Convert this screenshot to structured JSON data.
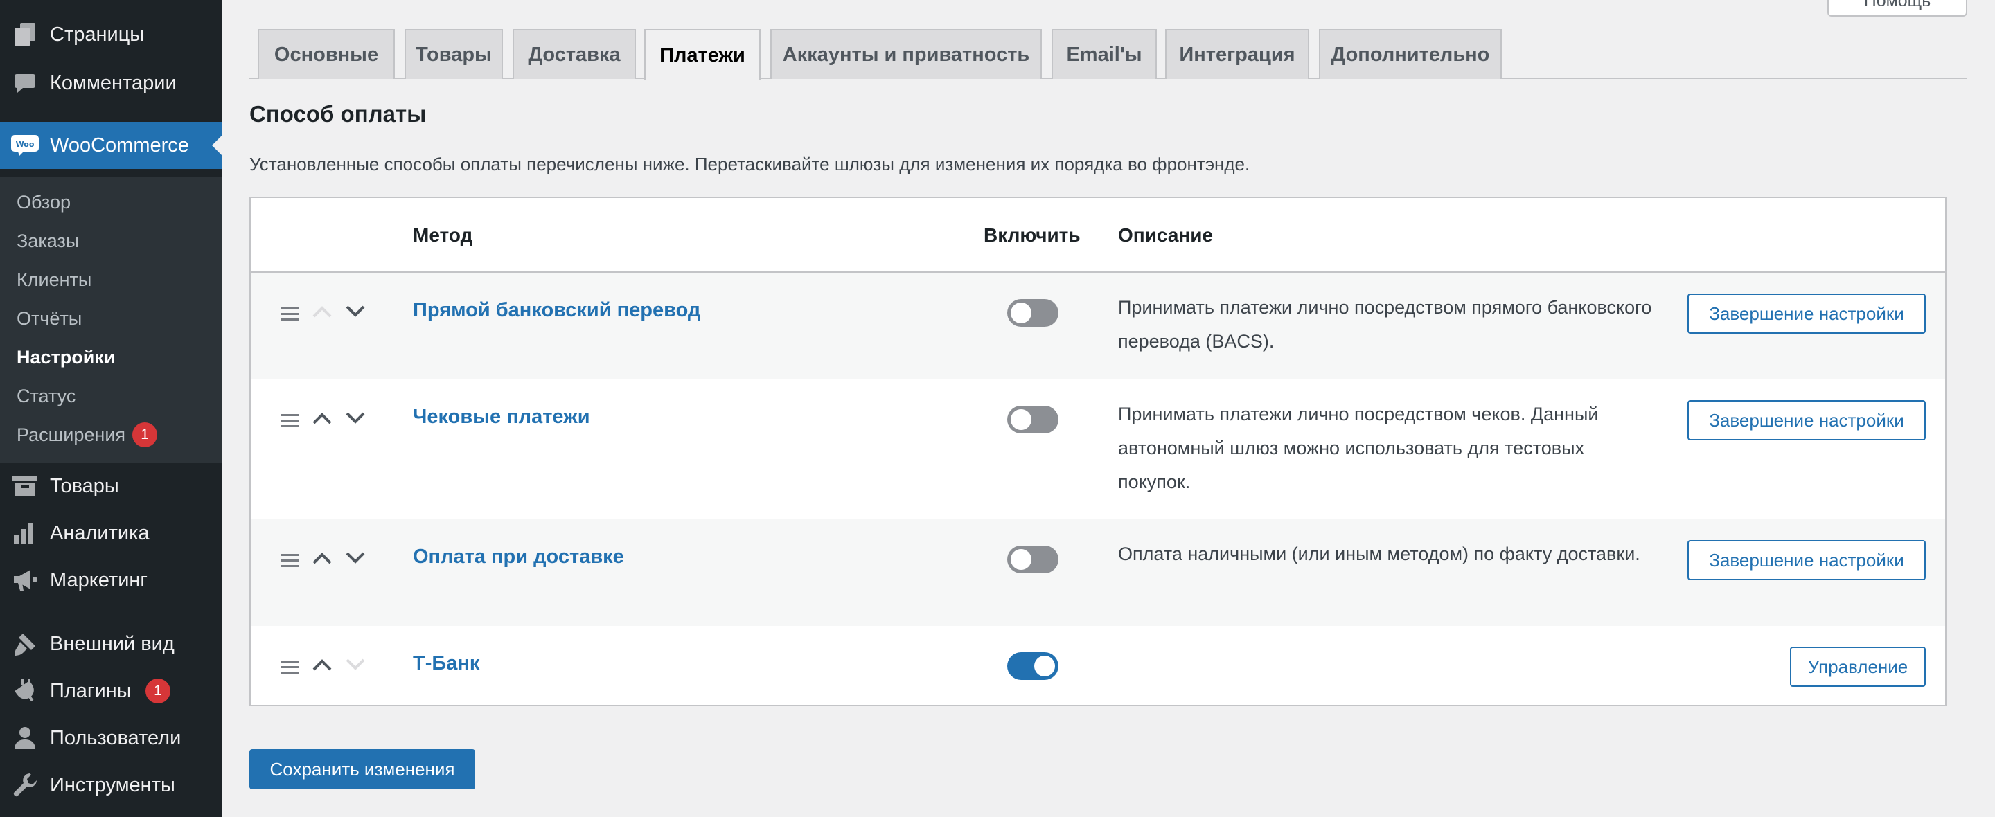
{
  "sidebar": {
    "items": [
      {
        "label": "Страницы",
        "icon": "pages-icon"
      },
      {
        "label": "Комментарии",
        "icon": "comments-icon"
      },
      {
        "label": "WooCommerce",
        "icon": "woocommerce-icon"
      },
      {
        "label": "Товары",
        "icon": "products-icon"
      },
      {
        "label": "Аналитика",
        "icon": "analytics-icon"
      },
      {
        "label": "Маркетинг",
        "icon": "marketing-icon"
      },
      {
        "label": "Внешний вид",
        "icon": "appearance-icon"
      },
      {
        "label": "Плагины",
        "icon": "plugins-icon",
        "badge": "1"
      },
      {
        "label": "Пользователи",
        "icon": "users-icon"
      },
      {
        "label": "Инструменты",
        "icon": "tools-icon"
      }
    ],
    "submenu": [
      {
        "label": "Обзор"
      },
      {
        "label": "Заказы"
      },
      {
        "label": "Клиенты"
      },
      {
        "label": "Отчёты"
      },
      {
        "label": "Настройки"
      },
      {
        "label": "Статус"
      },
      {
        "label": "Расширения",
        "badge": "1"
      }
    ]
  },
  "header": {
    "help_label": "Помощь"
  },
  "tabs": [
    {
      "label": "Основные"
    },
    {
      "label": "Товары"
    },
    {
      "label": "Доставка"
    },
    {
      "label": "Платежи"
    },
    {
      "label": "Аккаунты и приватность"
    },
    {
      "label": "Email'ы"
    },
    {
      "label": "Интеграция"
    },
    {
      "label": "Дополнительно"
    }
  ],
  "section": {
    "title": "Способ оплаты",
    "description": "Установленные способы оплаты перечислены ниже. Перетаскивайте шлюзы для изменения их порядка во фронтэнде."
  },
  "table": {
    "headers": {
      "method": "Метод",
      "enable": "Включить",
      "description": "Описание"
    },
    "rows": [
      {
        "name": "Прямой банковский перевод",
        "enabled": false,
        "description": "Принимать платежи лично посредством прямого банковского перевода (BACS).",
        "action": "Завершение настройки"
      },
      {
        "name": "Чековые платежи",
        "enabled": false,
        "description": "Принимать платежи лично посредством чеков. Данный автономный шлюз можно использовать для тестовых покупок.",
        "action": "Завершение настройки"
      },
      {
        "name": "Оплата при доставке",
        "enabled": false,
        "description": "Оплата наличными (или иным методом) по факту доставки.",
        "action": "Завершение настройки"
      },
      {
        "name": "Т-Банк",
        "enabled": true,
        "description": "",
        "action": "Управление"
      }
    ]
  },
  "footer": {
    "save_label": "Сохранить изменения"
  },
  "colors": {
    "accent": "#2271b1",
    "sidebar_bg": "#1d2327",
    "badge": "#d63638",
    "page_bg": "#f0f0f1"
  }
}
